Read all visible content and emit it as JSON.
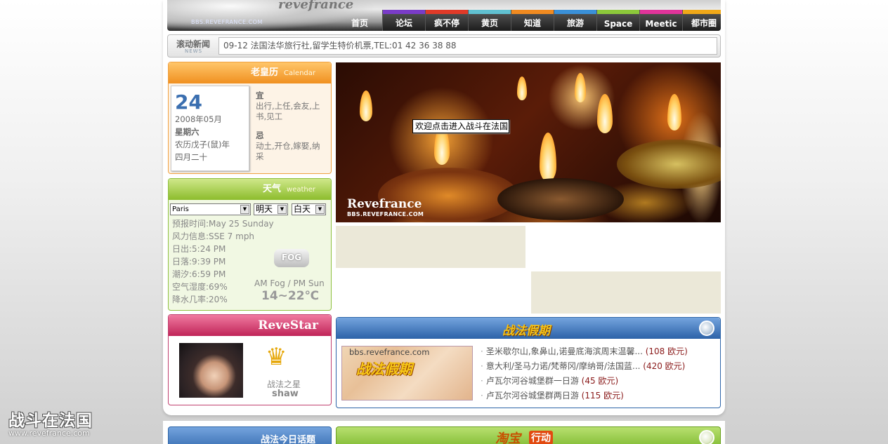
{
  "header": {
    "logo_text": "revefrance",
    "logo_url": "BBS.REVEFRANCE.COM",
    "nav": [
      {
        "label": "首页",
        "color": ""
      },
      {
        "label": "论坛",
        "color": "#7a3cc8"
      },
      {
        "label": "疯不停",
        "color": "#e03a28"
      },
      {
        "label": "黄页",
        "color": "#60c0d0"
      },
      {
        "label": "知道",
        "color": "#f08a20"
      },
      {
        "label": "旅游",
        "color": "#3a90d8"
      },
      {
        "label": "Space",
        "color": "#8cc83a"
      },
      {
        "label": "Meetic",
        "color": "#e0349a"
      },
      {
        "label": "都市圈",
        "color": "#f0a818"
      }
    ]
  },
  "news": {
    "label": "滚动新闻",
    "sub": "NEWS",
    "text": "09-12   法国法华旅行社,留学生特价机票,TEL:01 42 36 38 88"
  },
  "calendar": {
    "title": "老皇历",
    "title_en": "Calendar",
    "day": "24",
    "year_month": "2008年05月",
    "weekday": "星期六",
    "lunar_year": "农历戊子(鼠)年",
    "lunar_day": "四月二十",
    "good_head": "宜",
    "good": "出行,上任,会友,上书,见工",
    "bad_head": "忌",
    "bad": "动土,开仓,嫁娶,纳采"
  },
  "weather": {
    "title": "天气",
    "title_en": "weather",
    "city": "Paris",
    "day_select": "明天",
    "period_select": "白天",
    "lines": [
      "预报时间:May 25 Sunday",
      "风力信息:SSE 7 mph",
      "日出:5:24 PM",
      "日落:9:39 PM",
      "潮汐:6:59 PM",
      "空气湿度:69%",
      "降水几率:20%"
    ],
    "icon_label": "FOG",
    "condition": "AM Fog / PM Sun",
    "temperature": "14~22℃"
  },
  "revestar": {
    "title": "ReveStar",
    "label": "战法之星",
    "name": "shaw"
  },
  "banner": {
    "logo": "Revefrance",
    "url": "BBS.REVEFRANCE.COM",
    "tooltip": "欢迎点击进入战斗在法国"
  },
  "vacation": {
    "title": "战法假期",
    "image_url": "bbs.revefrance.com",
    "image_caption": "战法假期",
    "items": [
      {
        "text": "圣米歇尔山,象鼻山,诺曼底海滨周末温馨...",
        "price": "(108 欧元)"
      },
      {
        "text": "意大利/圣马力诺/梵蒂冈/摩纳哥/法国蓝...",
        "price": "(420 欧元)"
      },
      {
        "text": "卢瓦尔河谷城堡群一日游",
        "price": "(45 欧元)"
      },
      {
        "text": "卢瓦尔河谷城堡群两日游",
        "price": "(115 欧元)"
      }
    ]
  },
  "topic": {
    "title": "战法今日话题"
  },
  "taobao": {
    "title": "淘宝",
    "badge": "行动"
  },
  "watermark": {
    "big": "战斗在法国",
    "small": "www.revefrance.com"
  }
}
